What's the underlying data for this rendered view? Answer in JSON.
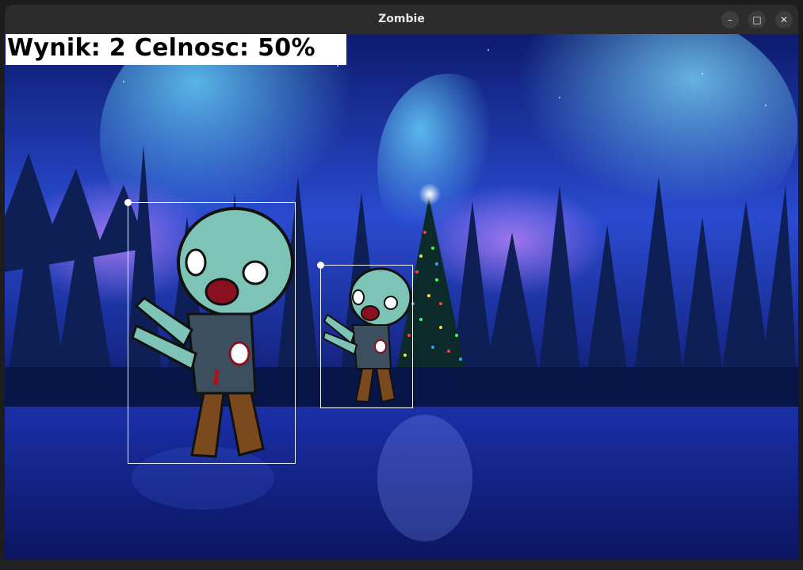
{
  "window": {
    "title": "Zombie",
    "minimize_glyph": "–",
    "maximize_glyph": "□",
    "close_glyph": "✕"
  },
  "hud": {
    "label": "Wynik: 2 Celnosc: 50%"
  },
  "scene": {
    "background": "night winter forest with aurora and lit christmas tree",
    "sky_color": "#1a2a8a",
    "aurora_color": "#5bb8ff",
    "ground_color": "#0a1a6a"
  },
  "zombies": [
    {
      "id": "zombie-1"
    },
    {
      "id": "zombie-2"
    }
  ]
}
